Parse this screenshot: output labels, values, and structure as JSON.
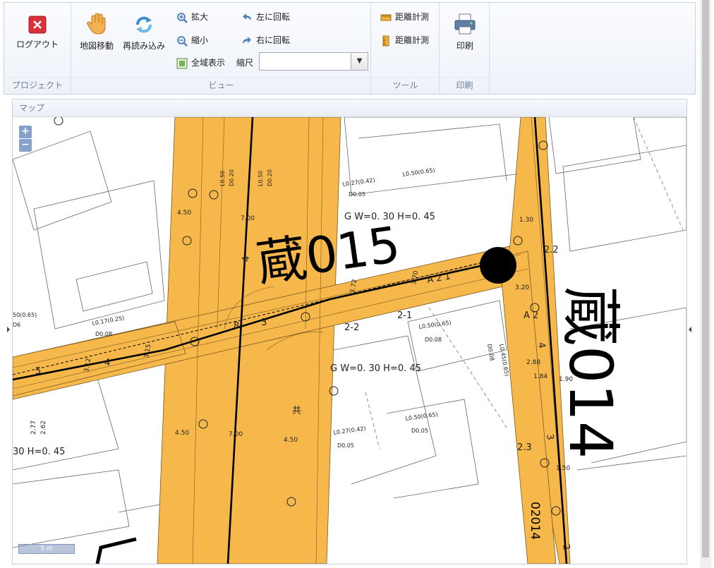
{
  "ribbon": {
    "project": {
      "logout_label": "ログアウト",
      "group_label": "プロジェクト"
    },
    "view": {
      "pan_label": "地図移動",
      "reload_label": "再読み込み",
      "zoom_in_label": "拡大",
      "zoom_out_label": "縮小",
      "full_extent_label": "全域表示",
      "rotate_left_label": "左に回転",
      "rotate_right_label": "右に回転",
      "scale_label": "縮尺",
      "scale_value": "",
      "group_label": "ビュー"
    },
    "tools": {
      "distance1_label": "距離計測",
      "distance2_label": "距離計測",
      "group_label": "ツール"
    },
    "print": {
      "print_label": "印刷",
      "group_label": "印刷"
    }
  },
  "map_panel": {
    "title": "マップ",
    "zoom_in": "+",
    "zoom_out": "−",
    "scale_bar": "5 m"
  },
  "map_labels": {
    "manhole_1": "蔵015",
    "manhole_2": "蔵014",
    "manhole_2_sub": "02014",
    "pipe_1": "G W=0. 30 H=0. 45",
    "pipe_2": "G W=0. 30 H=0. 45",
    "pipe_3": "30 H=0. 45",
    "lot_1": "2-2",
    "lot_2": "2-1",
    "a21": "A 2 1",
    "a2": "A 2",
    "lbl_22": "2.2",
    "lbl_23": "2.3",
    "l_027_042_a": "L0.27(0.42)",
    "l_005_a": "D0.05",
    "l_050_065_a": "L0.50(0.65)",
    "l_050_065_b": "L0.50(0.65)",
    "d008_a": "D0.08",
    "l_017_025": "L0.17(0.25)",
    "d008_b": "D0.08",
    "l_027_042_b": "L0.27(0.42)",
    "d005_b": "D0.05",
    "l_050_065_c": "L0.50(0.65)",
    "d005_c": "D0.05",
    "l_045_065": "L0.45(0.65)",
    "d008_c": "D0.08",
    "l_050_065_d": "50(0.65)",
    "d06": "D6",
    "w450a": "4.50",
    "w700a": "7.00",
    "w450b": "4.50",
    "w700b": "7.00",
    "w450c": "4.50",
    "w130": "1.30",
    "w320": "3.20",
    "w288": "2.88",
    "w184": "1.84",
    "w190": "1.90",
    "w150": "1.50",
    "w277": "2.77",
    "w262": "2.62",
    "w372": "3.72",
    "w370": "3.70",
    "w312": "3.12",
    "w315": "3.15",
    "num4a": "4",
    "num4b": "4",
    "num4c": "4",
    "num3a": "3",
    "num3b": "3",
    "num5": "5",
    "num8": "8",
    "num2": "2",
    "l050": "L0.50",
    "d020": "D0.20",
    "l050b": "L0.50",
    "d020b": "D0.20",
    "hydrant": "共"
  }
}
